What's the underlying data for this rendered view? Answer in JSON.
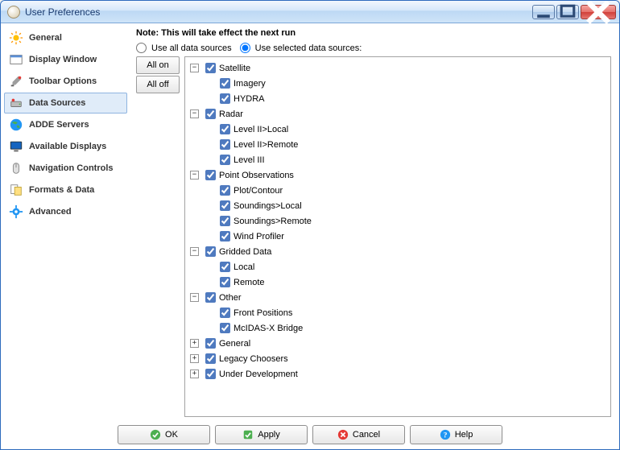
{
  "window": {
    "title": "User Preferences"
  },
  "sidebar": {
    "items": [
      {
        "label": "General",
        "icon": "sun-icon",
        "active": false
      },
      {
        "label": "Display Window",
        "icon": "window-icon",
        "active": false
      },
      {
        "label": "Toolbar Options",
        "icon": "tool-icon",
        "active": false
      },
      {
        "label": "Data Sources",
        "icon": "drive-icon",
        "active": true
      },
      {
        "label": "ADDE Servers",
        "icon": "globe-icon",
        "active": false
      },
      {
        "label": "Available Displays",
        "icon": "monitor-icon",
        "active": false
      },
      {
        "label": "Navigation Controls",
        "icon": "mouse-icon",
        "active": false
      },
      {
        "label": "Formats & Data",
        "icon": "format-icon",
        "active": false
      },
      {
        "label": "Advanced",
        "icon": "gear-icon",
        "active": false
      }
    ]
  },
  "content": {
    "note": "Note: This will take effect the next run",
    "radio_all": "Use all data sources",
    "radio_selected": "Use selected data sources:",
    "radio_value": "selected",
    "all_on": "All on",
    "all_off": "All off"
  },
  "tree": [
    {
      "label": "Satellite",
      "checked": true,
      "expanded": true,
      "children": [
        {
          "label": "Imagery",
          "checked": true
        },
        {
          "label": "HYDRA",
          "checked": true
        }
      ]
    },
    {
      "label": "Radar",
      "checked": true,
      "expanded": true,
      "children": [
        {
          "label": "Level II>Local",
          "checked": true
        },
        {
          "label": "Level II>Remote",
          "checked": true
        },
        {
          "label": "Level III",
          "checked": true
        }
      ]
    },
    {
      "label": "Point Observations",
      "checked": true,
      "expanded": true,
      "children": [
        {
          "label": "Plot/Contour",
          "checked": true
        },
        {
          "label": "Soundings>Local",
          "checked": true
        },
        {
          "label": "Soundings>Remote",
          "checked": true
        },
        {
          "label": "Wind Profiler",
          "checked": true
        }
      ]
    },
    {
      "label": "Gridded Data",
      "checked": true,
      "expanded": true,
      "children": [
        {
          "label": "Local",
          "checked": true
        },
        {
          "label": "Remote",
          "checked": true
        }
      ]
    },
    {
      "label": "Other",
      "checked": true,
      "expanded": true,
      "children": [
        {
          "label": "Front Positions",
          "checked": true
        },
        {
          "label": "McIDAS-X Bridge",
          "checked": true
        }
      ]
    },
    {
      "label": "General",
      "checked": true,
      "expanded": false,
      "children": [
        {}
      ]
    },
    {
      "label": "Legacy Choosers",
      "checked": true,
      "expanded": false,
      "children": [
        {}
      ]
    },
    {
      "label": "Under Development",
      "checked": true,
      "expanded": false,
      "children": [
        {}
      ]
    }
  ],
  "buttons": {
    "ok": "OK",
    "apply": "Apply",
    "cancel": "Cancel",
    "help": "Help"
  }
}
